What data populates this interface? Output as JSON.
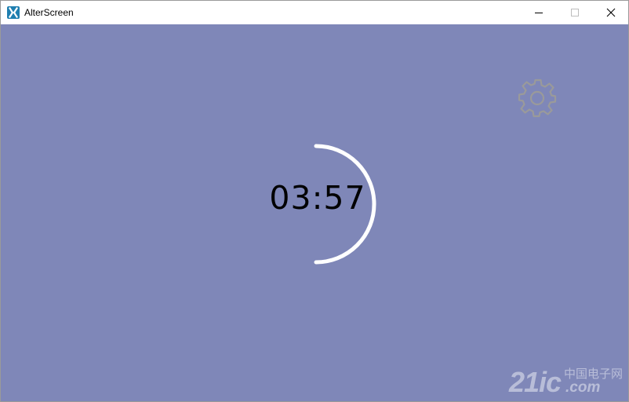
{
  "window": {
    "title": "AlterScreen",
    "icon": "app-x-icon",
    "controls": [
      "minimize-icon",
      "maximize-icon",
      "close-icon"
    ]
  },
  "main": {
    "background_color": "#7f87b8",
    "settings_icon": "gear-icon",
    "timer": {
      "display": "03:57",
      "ring_color": "#ffffff"
    }
  },
  "watermark": {
    "number": "21ic",
    "cn_text": "中国电子网",
    "domain": ".com"
  }
}
